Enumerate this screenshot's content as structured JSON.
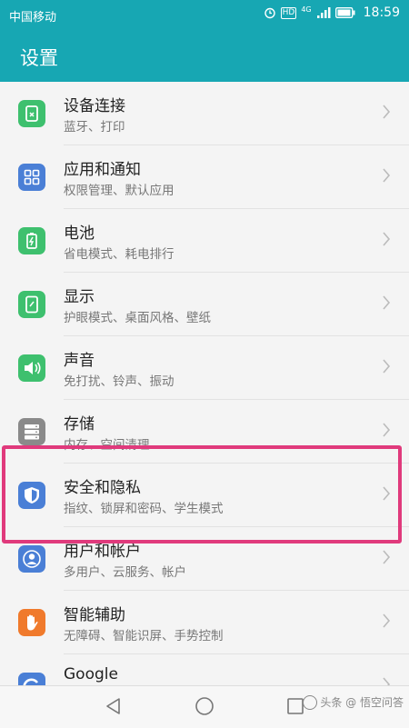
{
  "status_bar": {
    "carrier": "中国移动",
    "network_badge": "4G",
    "hd_badge": "HD",
    "time": "18:59"
  },
  "app_bar": {
    "title": "设置"
  },
  "settings": [
    {
      "label": "设备连接",
      "subtitle": "蓝牙、打印",
      "icon": "device-connection-icon",
      "color": "#3ec06e"
    },
    {
      "label": "应用和通知",
      "subtitle": "权限管理、默认应用",
      "icon": "apps-grid-icon",
      "color": "#4a7fd6"
    },
    {
      "label": "电池",
      "subtitle": "省电模式、耗电排行",
      "icon": "battery-icon",
      "color": "#3ec06e"
    },
    {
      "label": "显示",
      "subtitle": "护眼模式、桌面风格、壁纸",
      "icon": "display-icon",
      "color": "#3ec06e"
    },
    {
      "label": "声音",
      "subtitle": "免打扰、铃声、振动",
      "icon": "speaker-icon",
      "color": "#3ec06e"
    },
    {
      "label": "存储",
      "subtitle": "内存、空间清理",
      "icon": "storage-icon",
      "color": "#8a8a8a"
    },
    {
      "label": "安全和隐私",
      "subtitle": "指纹、锁屏和密码、学生模式",
      "icon": "shield-icon",
      "color": "#4a7fd6"
    },
    {
      "label": "用户和帐户",
      "subtitle": "多用户、云服务、帐户",
      "icon": "user-icon",
      "color": "#4a7fd6"
    },
    {
      "label": "智能辅助",
      "subtitle": "无障碍、智能识屏、手势控制",
      "icon": "hand-icon",
      "color": "#f07a2c"
    },
    {
      "label": "Google",
      "subtitle": "",
      "icon": "google-icon",
      "color": "#4a7fd6"
    }
  ],
  "highlight_color": "#e03a7c",
  "watermark": "头条 @ 悟空问答"
}
